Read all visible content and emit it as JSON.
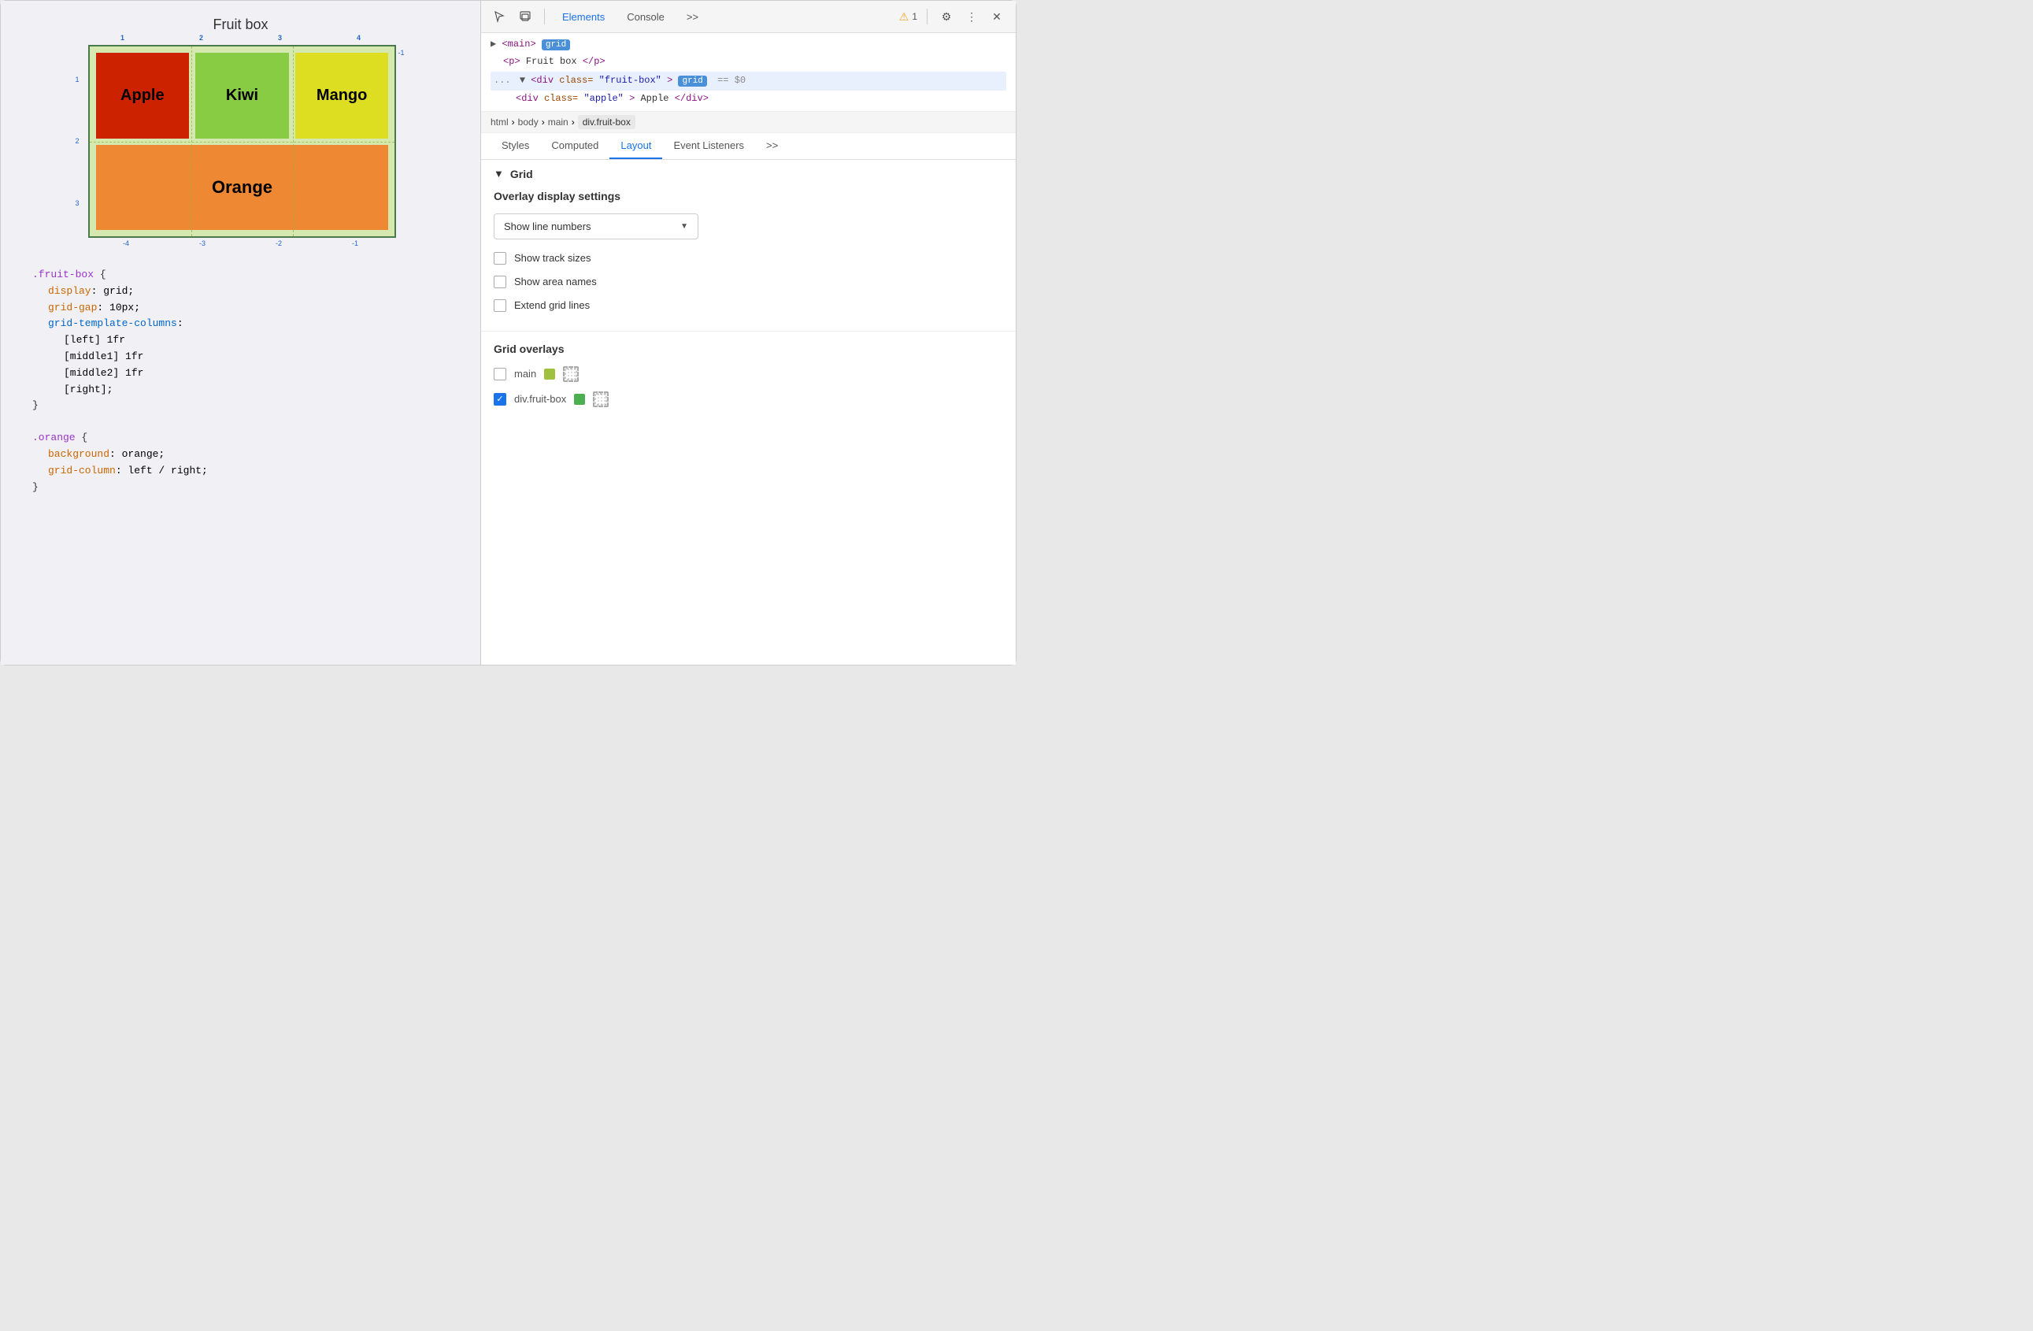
{
  "left": {
    "title": "Fruit box",
    "grid": {
      "cells": [
        {
          "id": "apple",
          "label": "Apple",
          "class": "g-apple"
        },
        {
          "id": "kiwi",
          "label": "Kiwi",
          "class": "g-kiwi"
        },
        {
          "id": "mango",
          "label": "Mango",
          "class": "g-mango"
        },
        {
          "id": "orange",
          "label": "Orange",
          "class": "g-orange"
        }
      ],
      "line_numbers": {
        "top": [
          "1",
          "2",
          "3",
          "4"
        ],
        "left": [
          "1",
          "2",
          "3"
        ],
        "bottom": [
          "-4",
          "-3",
          "-2",
          "-1"
        ],
        "right": [
          "-1"
        ]
      }
    },
    "code_blocks": [
      {
        "selector": ".fruit-box",
        "lines": [
          {
            "property": "display",
            "value": "grid"
          },
          {
            "property": "grid-gap",
            "value": "10px"
          },
          {
            "property": "grid-template-columns",
            "value": null
          },
          {
            "sublines": [
              "[left] 1fr",
              "[middle1] 1fr",
              "[middle2] 1fr",
              "[right];"
            ]
          }
        ]
      },
      {
        "selector": ".orange",
        "lines": [
          {
            "property": "background",
            "value": "orange"
          },
          {
            "property": "grid-column",
            "value": "left / right"
          }
        ]
      }
    ]
  },
  "devtools": {
    "header": {
      "tabs": [
        "Elements",
        "Console"
      ],
      "active_tab": "Elements",
      "more_label": ">>",
      "warning_count": "1",
      "icons": [
        "cursor-icon",
        "layers-icon",
        "more-icon",
        "settings-icon",
        "menu-icon",
        "close-icon"
      ]
    },
    "dom": {
      "lines": [
        {
          "indent": 0,
          "content": "▶ <main>",
          "badge": "grid",
          "suffix": ""
        },
        {
          "indent": 1,
          "content": "<p>Fruit box</p>",
          "badge": null,
          "suffix": ""
        },
        {
          "indent": 0,
          "content": "... ▼ <div class=\"fruit-box\">",
          "badge": "grid",
          "suffix": "== $0",
          "selected": true
        },
        {
          "indent": 2,
          "content": "<div class=\"apple\">Apple</div>",
          "badge": null,
          "suffix": ""
        }
      ]
    },
    "breadcrumb": [
      "html",
      "body",
      "main",
      "div.fruit-box"
    ],
    "active_breadcrumb": "div.fruit-box",
    "panel_tabs": [
      "Styles",
      "Computed",
      "Layout",
      "Event Listeners"
    ],
    "active_panel_tab": "Layout",
    "layout": {
      "grid_section_label": "Grid",
      "overlay_settings": {
        "title": "Overlay display settings",
        "dropdown_value": "Show line numbers",
        "dropdown_options": [
          "Show line numbers",
          "Show track sizes",
          "Show area names"
        ],
        "checkboxes": [
          {
            "label": "Show track sizes",
            "checked": false
          },
          {
            "label": "Show area names",
            "checked": false
          },
          {
            "label": "Extend grid lines",
            "checked": false
          }
        ]
      },
      "grid_overlays": {
        "title": "Grid overlays",
        "items": [
          {
            "label": "main",
            "swatch_color": "#a0c040",
            "checked": false
          },
          {
            "label": "div.fruit-box",
            "swatch_color": "#4caf50",
            "checked": true
          }
        ]
      }
    }
  }
}
